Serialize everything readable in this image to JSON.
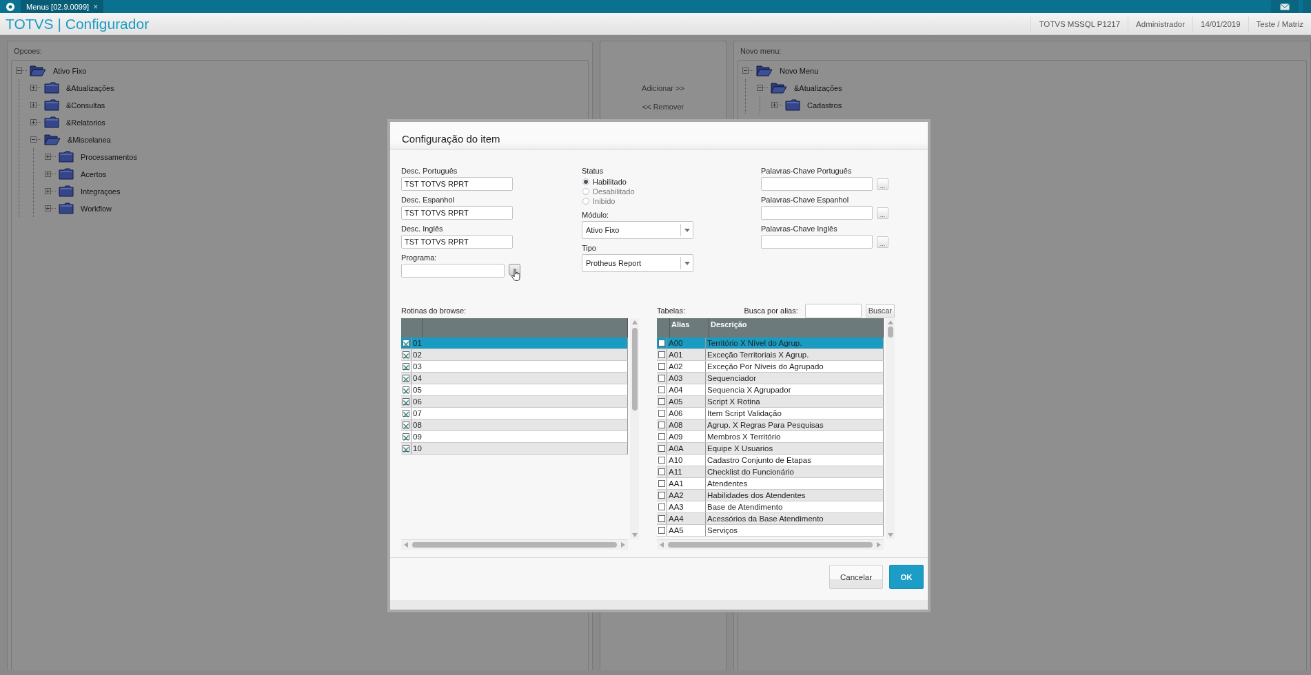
{
  "top_bar": {
    "tab": {
      "label": "Menus [02.9.0099]",
      "close": "×"
    }
  },
  "header": {
    "title": "TOTVS | Configurador",
    "info": [
      "TOTVS  MSSQL P1217",
      "Administrador",
      "14/01/2019",
      "Teste / Matriz"
    ]
  },
  "options_panel": {
    "label": "Opcoes:",
    "tree": [
      {
        "label": "Ativo Fixo",
        "expanded": true,
        "children": [
          {
            "label": "&Atualizações",
            "expanded": false
          },
          {
            "label": "&Consultas",
            "expanded": false
          },
          {
            "label": "&Relatorios",
            "expanded": false
          },
          {
            "label": "&Miscelanea",
            "expanded": true,
            "children": [
              {
                "label": "Processamentos",
                "expanded": false
              },
              {
                "label": "Acertos",
                "expanded": false
              },
              {
                "label": "Integraçoes",
                "expanded": false
              },
              {
                "label": "Workflow",
                "expanded": false
              }
            ]
          }
        ]
      }
    ]
  },
  "transfer": {
    "add": "Adicionar >>",
    "remove": "<< Remover"
  },
  "new_menu_panel": {
    "label": "Novo menu:",
    "tree": [
      {
        "label": "Novo Menu",
        "expanded": true,
        "children": [
          {
            "label": "&Atualizações",
            "expanded": true,
            "children": [
              {
                "label": "Cadastros",
                "expanded": false
              }
            ]
          }
        ]
      }
    ]
  },
  "dialog": {
    "title": "Configuração do item",
    "fields": [
      {
        "label": "Desc. Português",
        "value": "TST TOTVS RPRT"
      },
      {
        "label": "Desc. Espanhol",
        "value": "TST TOTVS RPRT"
      },
      {
        "label": "Desc. Inglês",
        "value": "TST TOTVS RPRT"
      }
    ],
    "program": {
      "label": "Programa:"
    },
    "status": {
      "label": "Status",
      "options": [
        {
          "label": "Habilitado",
          "selected": true
        },
        {
          "label": "Desabilitado",
          "selected": false
        },
        {
          "label": "Inibido",
          "selected": false
        }
      ]
    },
    "selects": [
      {
        "label": "Módulo:",
        "value": "Ativo Fixo"
      },
      {
        "label": "Tipo",
        "value": "Protheus Report"
      }
    ],
    "keywords": [
      {
        "label": "Palavras-Chave Português",
        "button": "..."
      },
      {
        "label": "Palavras-Chave Espanhol",
        "button": "..."
      },
      {
        "label": "Palavras-Chave Inglês",
        "button": "..."
      }
    ],
    "routines": {
      "label": "Rotinas do browse:",
      "rows": [
        {
          "value": "01",
          "checked": true,
          "selected": true
        },
        {
          "value": "02",
          "checked": true,
          "selected": false
        },
        {
          "value": "03",
          "checked": true,
          "selected": false
        },
        {
          "value": "04",
          "checked": true,
          "selected": false
        },
        {
          "value": "05",
          "checked": true,
          "selected": false
        },
        {
          "value": "06",
          "checked": true,
          "selected": false
        },
        {
          "value": "07",
          "checked": true,
          "selected": false
        },
        {
          "value": "08",
          "checked": true,
          "selected": false
        },
        {
          "value": "09",
          "checked": true,
          "selected": false
        },
        {
          "value": "10",
          "checked": true,
          "selected": false
        }
      ]
    },
    "tables": {
      "label": "Tabelas:",
      "search_label": "Busca por alias:",
      "search_button": "Buscar",
      "columns": [
        "Alias",
        "Descrição"
      ],
      "rows": [
        {
          "alias": "A00",
          "description": "Território X Nível do Agrup.",
          "checked": false,
          "selected": true
        },
        {
          "alias": "A01",
          "description": "Exceção Territoriais X Agrup.",
          "checked": false,
          "selected": false
        },
        {
          "alias": "A02",
          "description": "Exceção Por Níveis do Agrupado",
          "checked": false,
          "selected": false
        },
        {
          "alias": "A03",
          "description": "Sequenciador",
          "checked": false,
          "selected": false
        },
        {
          "alias": "A04",
          "description": "Sequencia X Agrupador",
          "checked": false,
          "selected": false
        },
        {
          "alias": "A05",
          "description": "Script X Rotina",
          "checked": false,
          "selected": false
        },
        {
          "alias": "A06",
          "description": "Item Script Validação",
          "checked": false,
          "selected": false
        },
        {
          "alias": "A08",
          "description": "Agrup. X Regras Para Pesquisas",
          "checked": false,
          "selected": false
        },
        {
          "alias": "A09",
          "description": "Membros X Território",
          "checked": false,
          "selected": false
        },
        {
          "alias": "A0A",
          "description": "Equipe X Usuarios",
          "checked": false,
          "selected": false
        },
        {
          "alias": "A10",
          "description": "Cadastro Conjunto de Etapas",
          "checked": false,
          "selected": false
        },
        {
          "alias": "A11",
          "description": "Checklist do Funcionário",
          "checked": false,
          "selected": false
        },
        {
          "alias": "AA1",
          "description": "Atendentes",
          "checked": false,
          "selected": false
        },
        {
          "alias": "AA2",
          "description": "Habilidades dos Atendentes",
          "checked": false,
          "selected": false
        },
        {
          "alias": "AA3",
          "description": "Base de Atendimento",
          "checked": false,
          "selected": false
        },
        {
          "alias": "AA4",
          "description": "Acessórios da Base Atendimento",
          "checked": false,
          "selected": false
        },
        {
          "alias": "AA5",
          "description": "Serviços",
          "checked": false,
          "selected": false
        }
      ]
    },
    "buttons": [
      {
        "label": "Cancelar",
        "kind": "secondary"
      },
      {
        "label": "OK",
        "kind": "primary"
      }
    ]
  }
}
